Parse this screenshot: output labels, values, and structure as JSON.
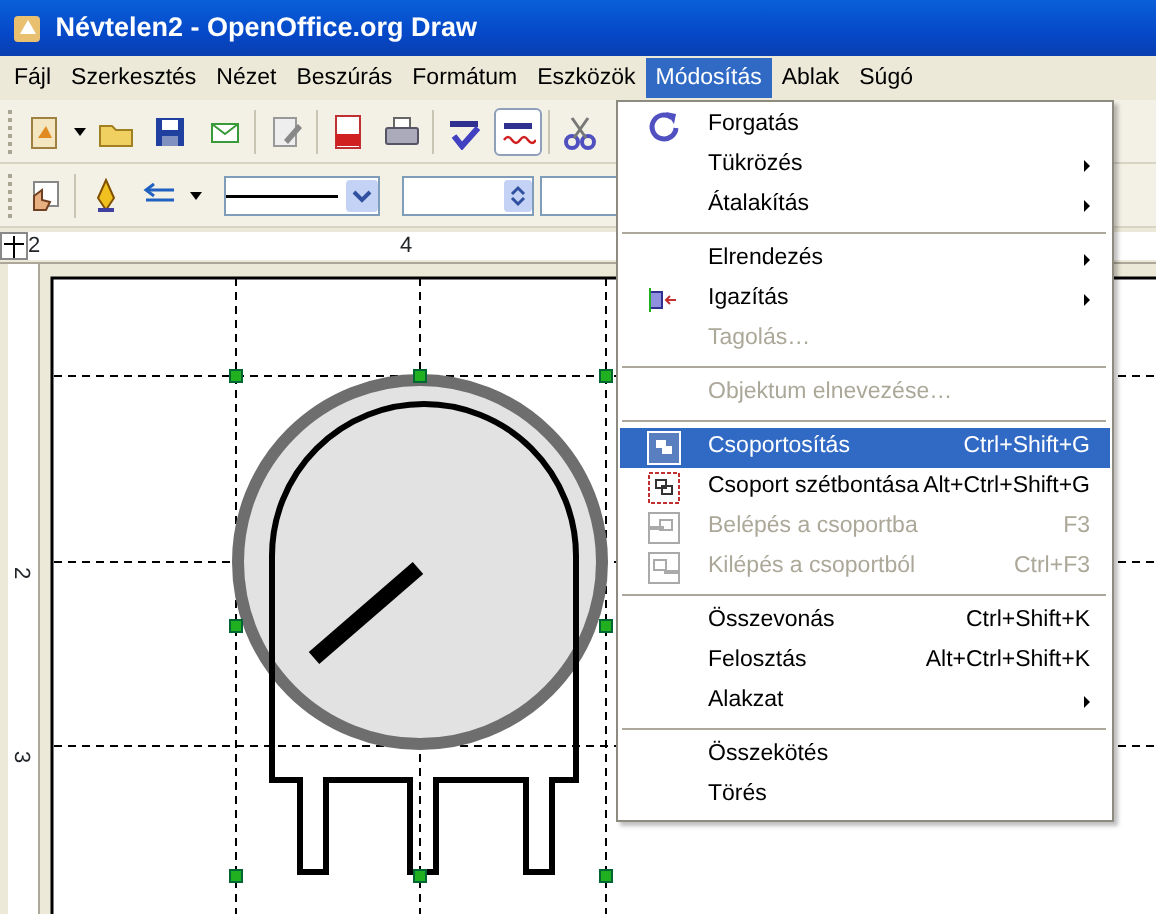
{
  "window": {
    "title": "Névtelen2 - OpenOffice.org Draw"
  },
  "menubar": [
    {
      "label": "Fájl",
      "selected": false
    },
    {
      "label": "Szerkesztés",
      "selected": false
    },
    {
      "label": "Nézet",
      "selected": false
    },
    {
      "label": "Beszúrás",
      "selected": false
    },
    {
      "label": "Formátum",
      "selected": false
    },
    {
      "label": "Eszközök",
      "selected": false
    },
    {
      "label": "Módosítás",
      "selected": true
    },
    {
      "label": "Ablak",
      "selected": false
    },
    {
      "label": "Súgó",
      "selected": false
    }
  ],
  "toolbar": {
    "spellcheck_auto_pressed": true
  },
  "ruler": {
    "horizontal": [
      "2",
      "4"
    ],
    "vertical": [
      "2",
      "3"
    ]
  },
  "menu": [
    {
      "kind": "item",
      "label": "Forgatás",
      "submenu": false,
      "disabled": false,
      "selected": false
    },
    {
      "kind": "item",
      "label": "Tükrözés",
      "submenu": true,
      "disabled": false,
      "selected": false
    },
    {
      "kind": "item",
      "label": "Átalakítás",
      "submenu": true,
      "disabled": false,
      "selected": false
    },
    {
      "kind": "separator"
    },
    {
      "kind": "item",
      "label": "Elrendezés",
      "submenu": true,
      "disabled": false,
      "selected": false
    },
    {
      "kind": "item",
      "label": "Igazítás",
      "submenu": true,
      "disabled": false,
      "selected": false
    },
    {
      "kind": "item",
      "label": "Tagolás…",
      "submenu": false,
      "disabled": true,
      "selected": false
    },
    {
      "kind": "separator"
    },
    {
      "kind": "item",
      "label": "Objektum elnevezése…",
      "submenu": false,
      "disabled": true,
      "selected": false
    },
    {
      "kind": "separator"
    },
    {
      "kind": "item",
      "label": "Csoportosítás",
      "shortcut": "Ctrl+Shift+G",
      "submenu": false,
      "disabled": false,
      "selected": true
    },
    {
      "kind": "item",
      "label": "Csoport szétbontása",
      "shortcut": "Alt+Ctrl+Shift+G",
      "submenu": false,
      "disabled": false,
      "selected": false
    },
    {
      "kind": "item",
      "label": "Belépés a csoportba",
      "shortcut": "F3",
      "submenu": false,
      "disabled": true,
      "selected": false
    },
    {
      "kind": "item",
      "label": "Kilépés a csoportból",
      "shortcut": "Ctrl+F3",
      "submenu": false,
      "disabled": true,
      "selected": false
    },
    {
      "kind": "separator"
    },
    {
      "kind": "item",
      "label": "Összevonás",
      "shortcut": "Ctrl+Shift+K",
      "submenu": false,
      "disabled": false,
      "selected": false
    },
    {
      "kind": "item",
      "label": "Felosztás",
      "shortcut": "Alt+Ctrl+Shift+K",
      "submenu": false,
      "disabled": false,
      "selected": false
    },
    {
      "kind": "item",
      "label": "Alakzat",
      "submenu": true,
      "disabled": false,
      "selected": false
    },
    {
      "kind": "separator"
    },
    {
      "kind": "item",
      "label": "Összekötés",
      "submenu": false,
      "disabled": false,
      "selected": false
    },
    {
      "kind": "item",
      "label": "Törés",
      "submenu": false,
      "disabled": false,
      "selected": false
    }
  ]
}
